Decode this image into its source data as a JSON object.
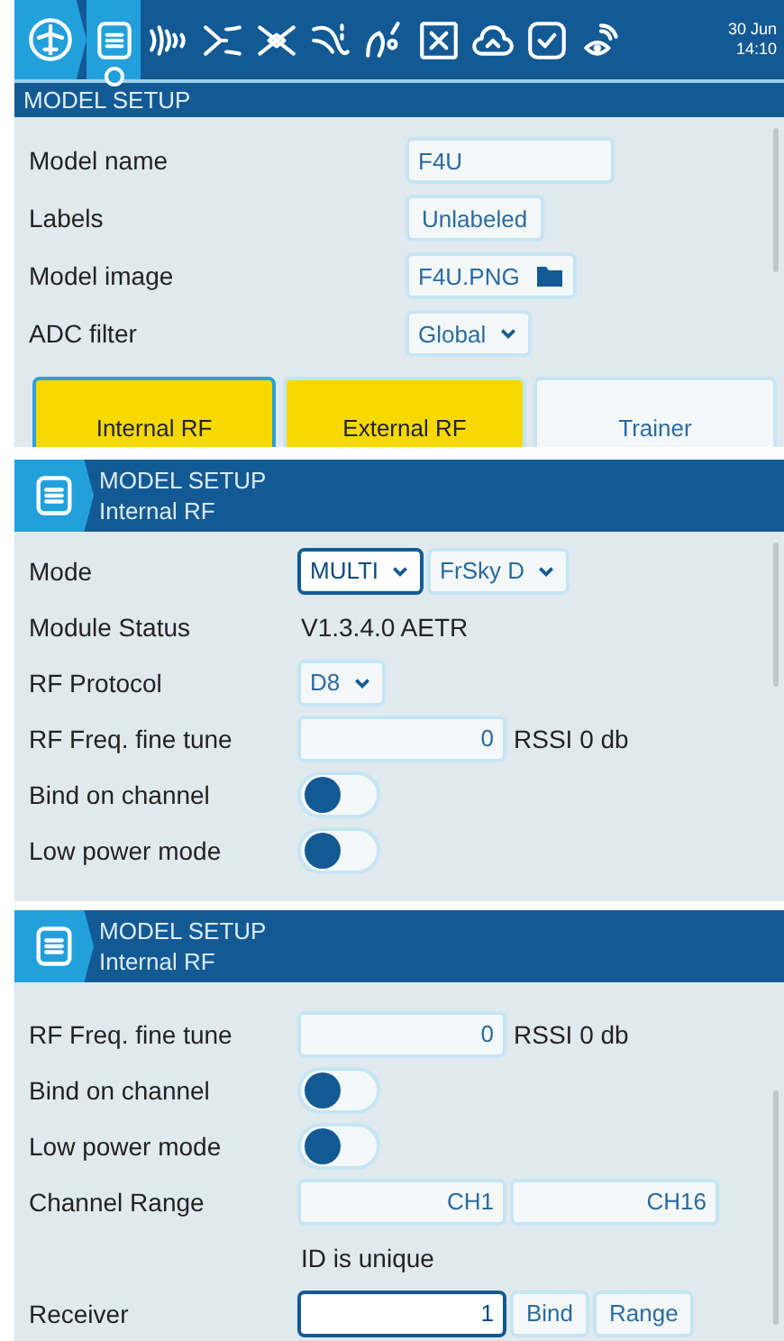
{
  "screens": [
    {
      "kind": "main",
      "topbar": {
        "tabs": [
          {
            "selected": true
          },
          {
            "selected": false
          },
          {
            "selected": false
          },
          {
            "selected": false
          },
          {
            "selected": false
          },
          {
            "selected": false
          },
          {
            "selected": false
          },
          {
            "selected": false
          },
          {
            "selected": false
          },
          {
            "selected": false
          }
        ],
        "date": "30 Jun",
        "time": "14:10"
      },
      "title": "MODEL SETUP",
      "rows": [
        {
          "label": "Model name",
          "controls": [
            {
              "kind": "text",
              "value": "F4U",
              "focused": false
            }
          ]
        },
        {
          "label": "Labels",
          "controls": [
            {
              "kind": "button",
              "value": "Unlabeled",
              "focused": false
            }
          ]
        },
        {
          "label": "Model image",
          "controls": [
            {
              "kind": "file",
              "value": "F4U.PNG",
              "focused": false
            }
          ]
        },
        {
          "label": "ADC filter",
          "controls": [
            {
              "kind": "select",
              "value": "Global",
              "focused": false
            }
          ]
        }
      ],
      "module_tabs": [
        {
          "label": "Internal RF",
          "on": true,
          "selected": true
        },
        {
          "label": "External RF",
          "on": true,
          "selected": false
        },
        {
          "label": "Trainer",
          "on": false,
          "selected": false
        }
      ]
    },
    {
      "kind": "sub",
      "title": "MODEL SETUP",
      "subtitle": "Internal RF",
      "rows": [
        {
          "label": "Mode",
          "controls": [
            {
              "kind": "select",
              "value": "MULTI",
              "focused": true
            },
            {
              "kind": "select",
              "value": "FrSky D",
              "focused": false
            }
          ]
        },
        {
          "label": "Module Status",
          "controls": [
            {
              "kind": "static",
              "value": "V1.3.4.0 AETR"
            }
          ]
        },
        {
          "label": "RF Protocol",
          "controls": [
            {
              "kind": "select",
              "value": "D8",
              "focused": false
            }
          ]
        },
        {
          "label": "RF Freq. fine tune",
          "controls": [
            {
              "kind": "number",
              "value": "0",
              "focused": false
            },
            {
              "kind": "static",
              "value": "RSSI 0 db"
            }
          ]
        },
        {
          "label": "Bind on channel",
          "controls": [
            {
              "kind": "toggle",
              "on": false
            }
          ]
        },
        {
          "label": "Low power mode",
          "controls": [
            {
              "kind": "toggle",
              "on": false
            }
          ]
        }
      ]
    },
    {
      "kind": "sub",
      "title": "MODEL SETUP",
      "subtitle": "Internal RF",
      "rows": [
        {
          "label": "RF Freq. fine tune",
          "controls": [
            {
              "kind": "number",
              "value": "0",
              "focused": false
            },
            {
              "kind": "static",
              "value": "RSSI 0 db"
            }
          ]
        },
        {
          "label": "Bind on channel",
          "controls": [
            {
              "kind": "toggle",
              "on": false
            }
          ]
        },
        {
          "label": "Low power mode",
          "controls": [
            {
              "kind": "toggle",
              "on": false
            }
          ]
        },
        {
          "label": "Channel Range",
          "controls": [
            {
              "kind": "number",
              "value": "CH1",
              "focused": false
            },
            {
              "kind": "number",
              "value": "CH16",
              "focused": false
            }
          ]
        },
        {
          "controls": [
            {
              "kind": "static",
              "value": "ID is unique"
            }
          ]
        },
        {
          "label": "Receiver",
          "controls": [
            {
              "kind": "number",
              "value": "1",
              "focused": true
            },
            {
              "kind": "button",
              "value": "Bind",
              "focused": false
            },
            {
              "kind": "button",
              "value": "Range",
              "focused": false
            }
          ]
        }
      ]
    }
  ]
}
